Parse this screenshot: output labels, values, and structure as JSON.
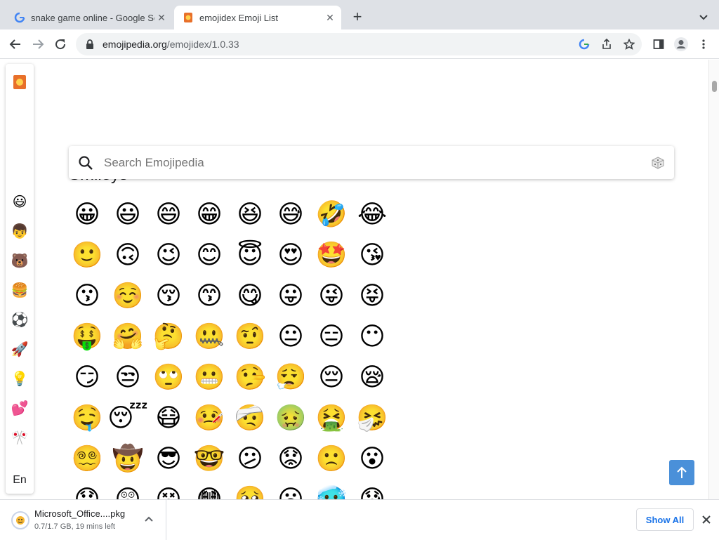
{
  "browser": {
    "tabs": [
      {
        "title": "snake game online - Google Se",
        "favicon": "google-g-icon",
        "active": false
      },
      {
        "title": "emojidex Emoji List",
        "favicon": "emojidex-icon",
        "active": true
      }
    ],
    "url_host": "emojipedia.org",
    "url_path": "/emojidex/1.0.33"
  },
  "sidebar": {
    "items": [
      {
        "icon": "emojidex-logo-icon",
        "glyph": "📙"
      },
      {
        "icon": "smileys-category-icon",
        "glyph": "😃"
      },
      {
        "icon": "people-category-icon",
        "glyph": "👦"
      },
      {
        "icon": "animals-category-icon",
        "glyph": "🐻"
      },
      {
        "icon": "food-category-icon",
        "glyph": "🍔"
      },
      {
        "icon": "activities-category-icon",
        "glyph": "⚽"
      },
      {
        "icon": "travel-category-icon",
        "glyph": "🚀"
      },
      {
        "icon": "objects-category-icon",
        "glyph": "💡"
      },
      {
        "icon": "symbols-category-icon",
        "glyph": "💕"
      },
      {
        "icon": "flags-category-icon",
        "glyph": "🎌"
      }
    ],
    "language": "En"
  },
  "search": {
    "placeholder": "Search Emojipedia",
    "value": ""
  },
  "section": {
    "heading": "Smileys"
  },
  "emojis": [
    "😀",
    "😃",
    "😄",
    "😁",
    "😆",
    "😅",
    "🤣",
    "😂",
    "🙂",
    "🙃",
    "😉",
    "😊",
    "😇",
    "😍",
    "🤩",
    "😘",
    "😗",
    "☺️",
    "😚",
    "😙",
    "😋",
    "😛",
    "😜",
    "😝",
    "🤑",
    "🤗",
    "🤔",
    "🤐",
    "🤨",
    "😐",
    "😑",
    "😶",
    "😏",
    "😒",
    "🙄",
    "😬",
    "🤥",
    "😮‍💨",
    "😔",
    "😪",
    "🤤",
    "😴",
    "😷",
    "🤒",
    "🤕",
    "🤢",
    "🤮",
    "🤧",
    "😵‍💫",
    "🤠",
    "😎",
    "🤓",
    "😕",
    "😟",
    "🙁",
    "😮",
    "😯",
    "😲",
    "😵",
    "😳",
    "🥺",
    "😦",
    "🥶",
    "😰"
  ],
  "download": {
    "filename": "Microsoft_Office....pkg",
    "status": "0.7/1.7 GB, 19 mins left",
    "show_all": "Show All"
  }
}
